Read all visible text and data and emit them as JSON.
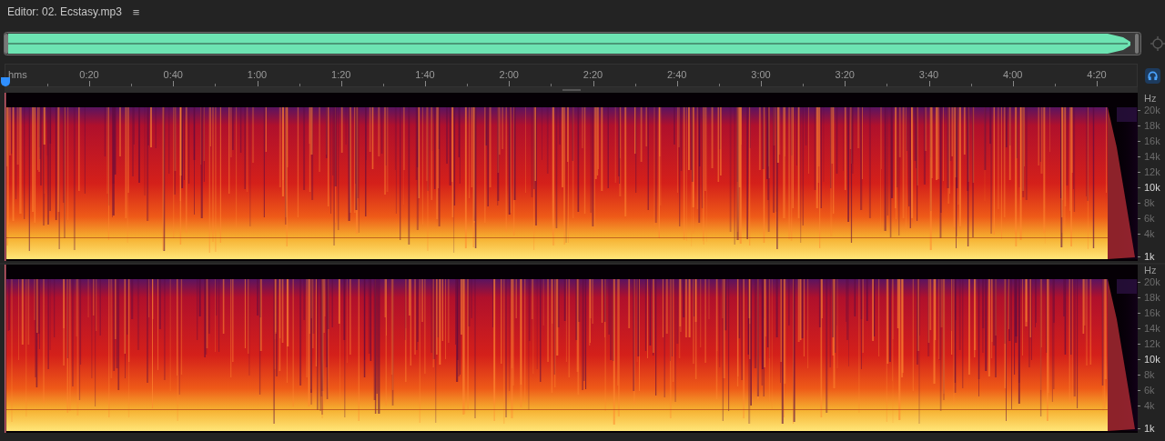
{
  "panel": {
    "title": "Editor: 02. Ecstasy.mp3",
    "menu_glyph": "≡"
  },
  "timeline": {
    "unit": "hms",
    "labels": [
      "0:20",
      "0:40",
      "1:00",
      "1:20",
      "1:40",
      "2:00",
      "2:20",
      "2:40",
      "3:00",
      "3:20",
      "3:40",
      "4:00",
      "4:20"
    ]
  },
  "channels": [
    {
      "unit": "Hz",
      "labels": [
        {
          "text": "20k",
          "major": false
        },
        {
          "text": "18k",
          "major": false
        },
        {
          "text": "16k",
          "major": false
        },
        {
          "text": "14k",
          "major": false
        },
        {
          "text": "12k",
          "major": false
        },
        {
          "text": "10k",
          "major": true
        },
        {
          "text": "8k",
          "major": false
        },
        {
          "text": "6k",
          "major": false
        },
        {
          "text": "4k",
          "major": false
        },
        {
          "text": "1k",
          "major": true
        }
      ]
    },
    {
      "unit": "Hz",
      "labels": [
        {
          "text": "20k",
          "major": false
        },
        {
          "text": "18k",
          "major": false
        },
        {
          "text": "16k",
          "major": false
        },
        {
          "text": "14k",
          "major": false
        },
        {
          "text": "12k",
          "major": false
        },
        {
          "text": "10k",
          "major": true
        },
        {
          "text": "8k",
          "major": false
        },
        {
          "text": "6k",
          "major": false
        },
        {
          "text": "4k",
          "major": false
        },
        {
          "text": "1k",
          "major": true
        }
      ]
    }
  ]
}
